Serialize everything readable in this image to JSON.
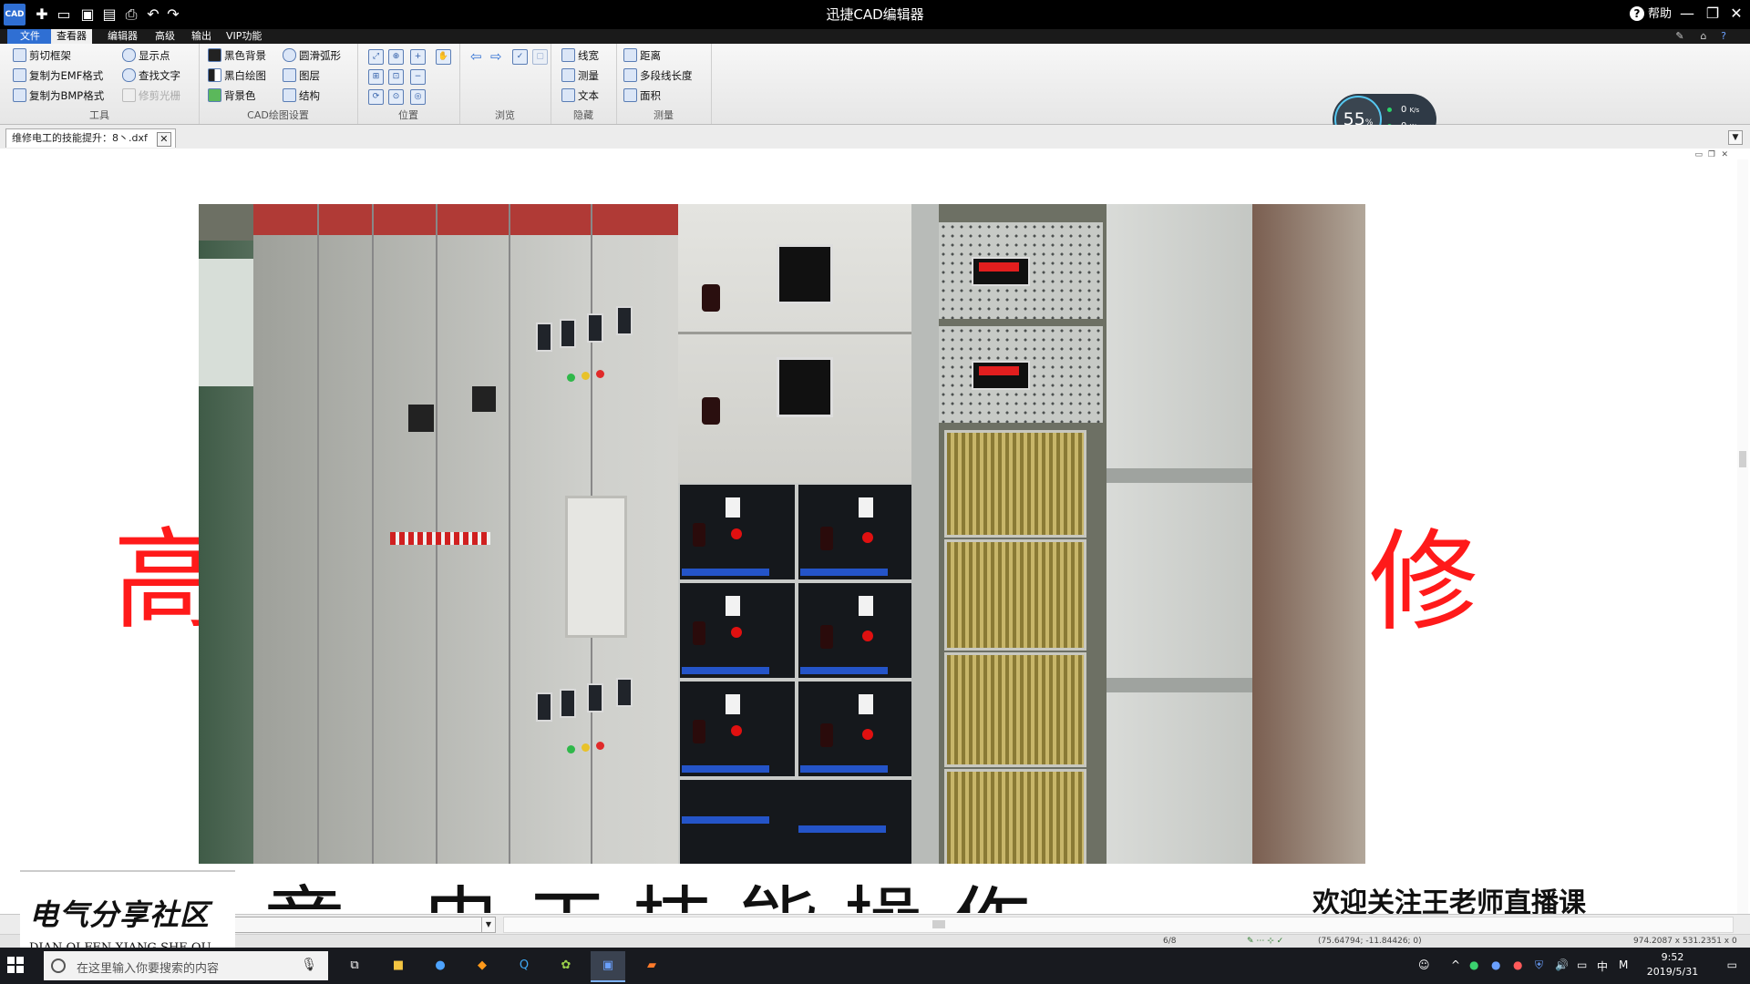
{
  "titlebar": {
    "app_icon_text": "CAD",
    "title": "迅捷CAD编辑器",
    "help_label": "帮助",
    "window_controls": {
      "minimize": "—",
      "restore": "❐",
      "close": "✕"
    }
  },
  "menu": {
    "items": [
      "文件",
      "查看器",
      "编辑器",
      "高级",
      "输出",
      "VIP功能"
    ],
    "active": "查看器"
  },
  "ribbon": {
    "tools": {
      "label": "工具",
      "items": [
        "剪切框架",
        "复制为EMF格式",
        "复制为BMP格式",
        "显示点",
        "查找文字",
        "修剪光栅"
      ]
    },
    "cad_settings": {
      "label": "CAD绘图设置",
      "items": [
        "黑色背景",
        "黑白绘图",
        "背景色",
        "圆滑弧形",
        "图层",
        "结构"
      ]
    },
    "position": {
      "label": "位置"
    },
    "browse": {
      "label": "浏览"
    },
    "hide": {
      "label": "隐藏",
      "items": [
        "线宽",
        "测量",
        "文本"
      ]
    },
    "measure": {
      "label": "测量",
      "items": [
        "距离",
        "多段线长度",
        "面积"
      ]
    }
  },
  "speed_widget": {
    "percent": "55",
    "unit": "%",
    "up": "0",
    "down": "0",
    "rate_unit": "K/s"
  },
  "document_tab": {
    "title": "维修电工的技能提升：8丶.dxf"
  },
  "slide": {
    "left_char": "高",
    "right_char": "修",
    "bottom_text": "章  电工技能操作 ",
    "welcome": "欢迎关注王老师直播课"
  },
  "watermark": {
    "cn": "电气分享社区",
    "pinyin": "DIAN QI FEN XIANG SHE QU"
  },
  "statusbar": {
    "page": "6/8",
    "coords": "(75.64794; -11.84426; 0)",
    "size": "974.2087 x 531.2351 x 0"
  },
  "taskbar": {
    "search_placeholder": "在这里输入你要搜索的内容",
    "time": "9:52",
    "date": "2019/5/31",
    "ime": "中",
    "apps": [
      "task-view",
      "file-explorer",
      "browser-s",
      "app-orange",
      "app-q",
      "app-color",
      "cad-app",
      "app-ppt"
    ]
  },
  "colors": {
    "titlebar_bg": "#000000",
    "accent_blue": "#2f6fd3",
    "slide_red": "#ff1a1a",
    "taskbar_bg": "#181a1f"
  }
}
